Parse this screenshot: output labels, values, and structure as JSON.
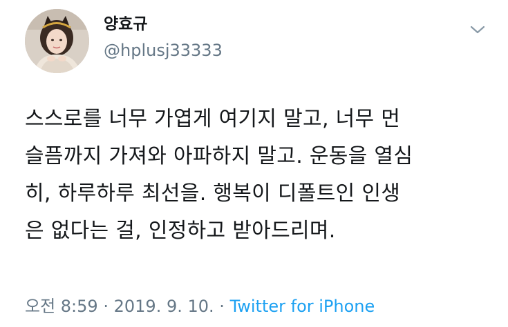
{
  "author": {
    "display_name": "양효규",
    "handle": "@hplusj33333",
    "avatar_icon": "profile-photo"
  },
  "menu_icon": "chevron-down-icon",
  "tweet": {
    "text": "스스로를 너무 가엽게 여기지 말고, 너무 먼\n슬픔까지 가져와 아파하지 말고. 운동을 열심\n히, 하루하루 최선을. 행복이 디폴트인 인생\n은 없다는 걸, 인정하고 받아드리며."
  },
  "meta": {
    "time": "오전 8:59",
    "separator": "·",
    "date": "2019. 9. 10.",
    "source": "Twitter for iPhone"
  },
  "colors": {
    "text": "#14171a",
    "secondary": "#657786",
    "link": "#1da1f2"
  }
}
